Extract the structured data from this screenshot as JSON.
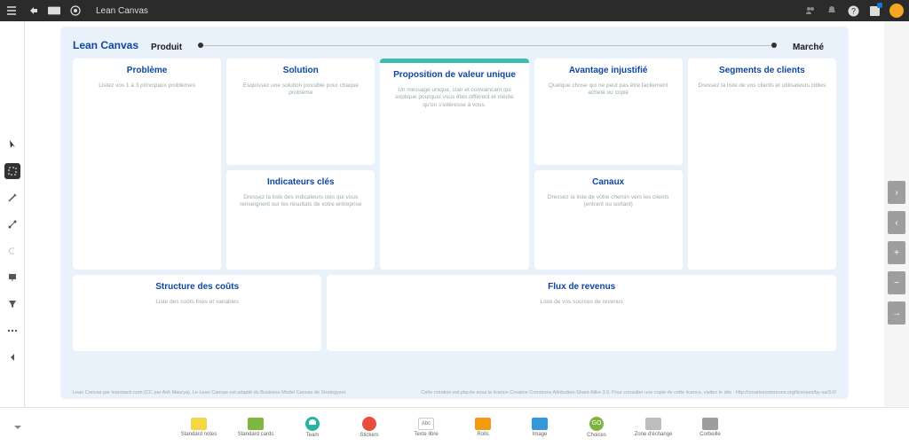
{
  "header": {
    "title": "Lean Canvas"
  },
  "canvas": {
    "title": "Lean Canvas",
    "axis_left": "Produit",
    "axis_right": "Marché",
    "cards": {
      "problem": {
        "title": "Problème",
        "desc": "Listez vos 1 à 3 principaux problèmes"
      },
      "solution": {
        "title": "Solution",
        "desc": "Esquissez une solution possible pour chaque problème"
      },
      "uvp": {
        "title": "Proposition de valeur unique",
        "desc": "Un message unique, clair et convaincant qui explique pourquoi vous êtes différent et mérite qu'on s'intéresse à vous."
      },
      "advantage": {
        "title": "Avantage injustifié",
        "desc": "Quelque chose qui ne peut pas être facilement acheté ou copié"
      },
      "segments": {
        "title": "Segments de clients",
        "desc": "Dressez la liste de vos clients et utilisateurs cibles"
      },
      "metrics": {
        "title": "Indicateurs clés",
        "desc": "Dressez la liste des indicateurs clés qui vous renseignent sur les résultats de votre entreprise"
      },
      "channels": {
        "title": "Canaux",
        "desc": "Dressez la liste de votre chemin vers les clients (entrant ou sortant)"
      },
      "costs": {
        "title": "Structure des coûts",
        "desc": "Liste des coûts fixes et variables"
      },
      "revenue": {
        "title": "Flux de revenus",
        "desc": "Liste de vos sources de revenus"
      }
    },
    "footnote_left": "Lean Canvas par leanstack.com (CC par Ash Maurya).\nLe Lean Canvas est adapté du Business Model Canvas de Strategyzer.",
    "footnote_right": "Cette création est placée sous la licence Creative Commons Attribution-Share Alike 3.0.\nPour consulter une copie de cette licence, visitez le site : http://creativecommons.org/licenses/by-sa/3.0/"
  },
  "dock": {
    "items": [
      {
        "label": "Standard notes"
      },
      {
        "label": "Standard cards"
      },
      {
        "label": "Team"
      },
      {
        "label": "Stickers"
      },
      {
        "label": "Texte libre",
        "glyph": "Abc"
      },
      {
        "label": "Rolls"
      },
      {
        "label": "Image"
      },
      {
        "label": "Choices",
        "glyph": "GO"
      },
      {
        "label": "Zone d'échange"
      },
      {
        "label": "Corbeille"
      }
    ]
  }
}
